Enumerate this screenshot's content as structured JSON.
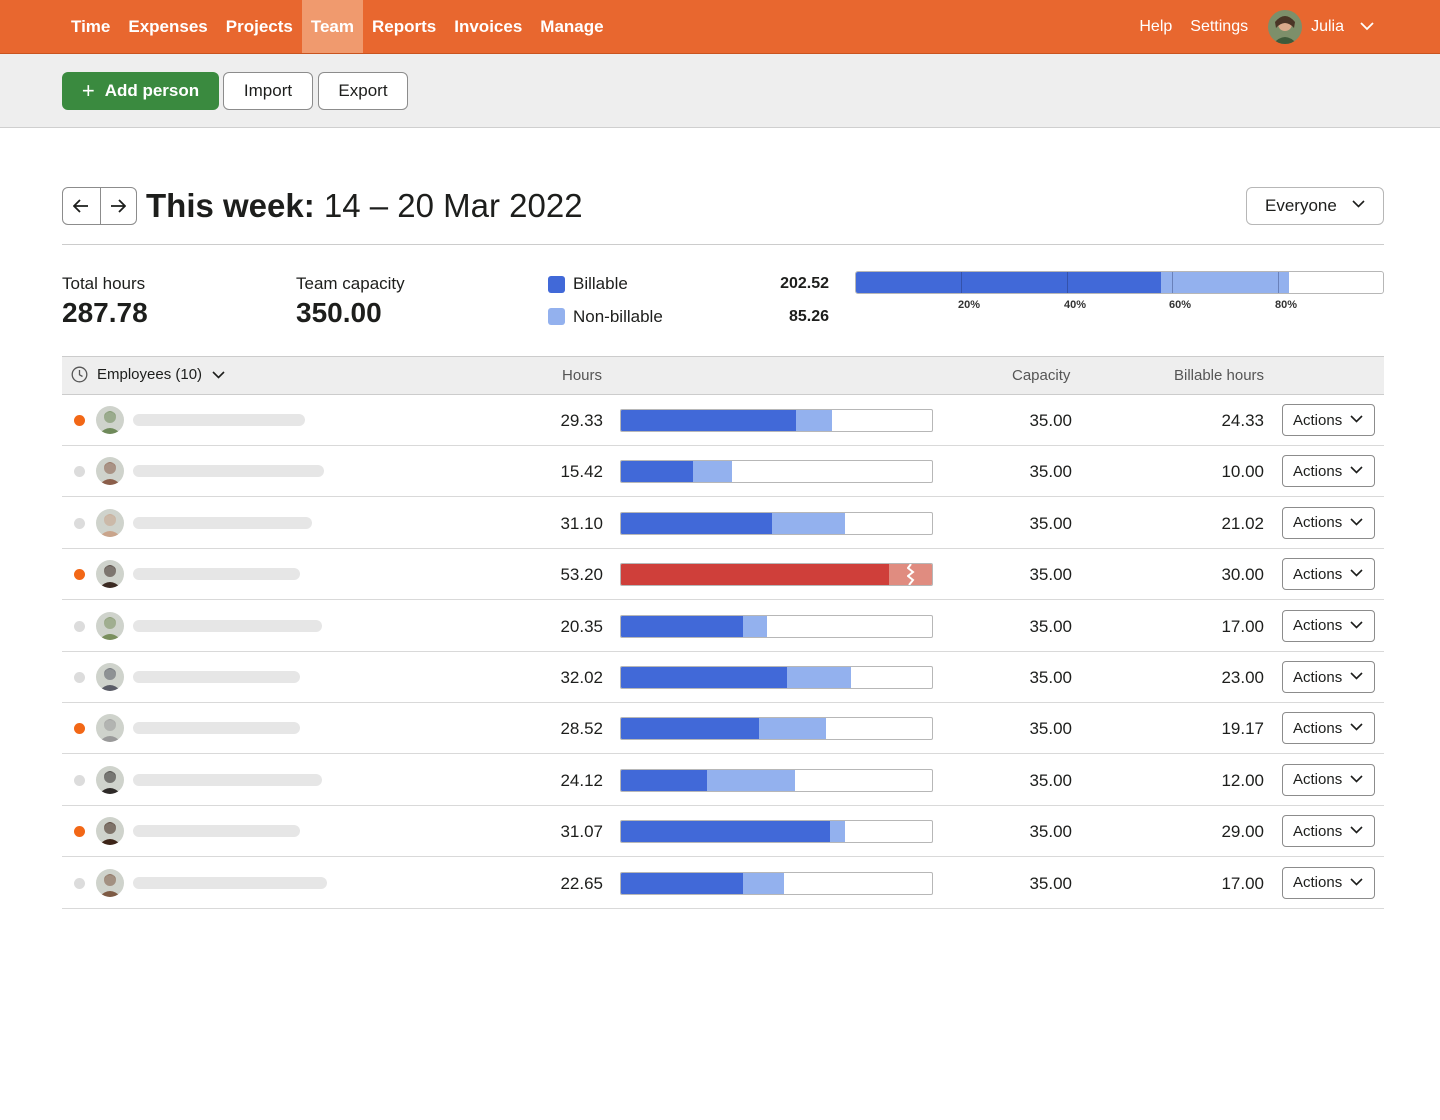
{
  "nav": {
    "items": [
      {
        "label": "Time",
        "active": false
      },
      {
        "label": "Expenses",
        "active": false
      },
      {
        "label": "Projects",
        "active": false
      },
      {
        "label": "Team",
        "active": true
      },
      {
        "label": "Reports",
        "active": false
      },
      {
        "label": "Invoices",
        "active": false
      },
      {
        "label": "Manage",
        "active": false
      }
    ],
    "help": "Help",
    "settings": "Settings",
    "user_name": "Julia"
  },
  "toolbar": {
    "add_person": "Add person",
    "add_icon": "plus-icon",
    "import": "Import",
    "export": "Export"
  },
  "week": {
    "title_bold": "This week:",
    "title_range": " 14 – 20 Mar 2022",
    "filter": "Everyone"
  },
  "summary": {
    "total_hours_label": "Total hours",
    "total_hours": "287.78",
    "capacity_label": "Team capacity",
    "capacity": "350.00",
    "billable_label": "Billable",
    "billable": "202.52",
    "nonbillable_label": "Non-billable",
    "nonbillable": "85.26",
    "bar_billable_fraction": 0.5786,
    "bar_nonbillable_fraction": 0.2436,
    "ticks": [
      "20%",
      "40%",
      "60%",
      "80%"
    ]
  },
  "table": {
    "employees_label": "Employees (10)",
    "col_hours": "Hours",
    "col_capacity": "Capacity",
    "col_billable": "Billable hours",
    "actions_label": "Actions",
    "rows": [
      {
        "status": "over-alert",
        "hours": "29.33",
        "h": 29.33,
        "b": 24.33,
        "capacity": "35.00",
        "billable": "24.33",
        "over": false,
        "avatar": "#6f8a5a"
      },
      {
        "status": "normal",
        "hours": "15.42",
        "h": 15.42,
        "b": 10.0,
        "capacity": "35.00",
        "billable": "10.00",
        "over": false,
        "avatar": "#8b5e4a"
      },
      {
        "status": "normal",
        "hours": "31.10",
        "h": 31.1,
        "b": 21.02,
        "capacity": "35.00",
        "billable": "21.02",
        "over": false,
        "avatar": "#c9a48b"
      },
      {
        "status": "over-alert",
        "hours": "53.20",
        "h": 53.2,
        "b": 30.0,
        "capacity": "35.00",
        "billable": "30.00",
        "over": true,
        "avatar": "#3b2a22"
      },
      {
        "status": "normal",
        "hours": "20.35",
        "h": 20.35,
        "b": 17.0,
        "capacity": "35.00",
        "billable": "17.00",
        "over": false,
        "avatar": "#7a8f5e"
      },
      {
        "status": "normal",
        "hours": "32.02",
        "h": 32.02,
        "b": 23.0,
        "capacity": "35.00",
        "billable": "23.00",
        "over": false,
        "avatar": "#5a5c66"
      },
      {
        "status": "over-alert",
        "hours": "28.52",
        "h": 28.52,
        "b": 19.17,
        "capacity": "35.00",
        "billable": "19.17",
        "over": false,
        "avatar": "#9a9a9a"
      },
      {
        "status": "normal",
        "hours": "24.12",
        "h": 24.12,
        "b": 12.0,
        "capacity": "35.00",
        "billable": "12.00",
        "over": false,
        "avatar": "#2e2a28"
      },
      {
        "status": "over-alert",
        "hours": "31.07",
        "h": 31.07,
        "b": 29.0,
        "capacity": "35.00",
        "billable": "29.00",
        "over": false,
        "avatar": "#3d2418"
      },
      {
        "status": "normal",
        "hours": "22.65",
        "h": 22.65,
        "b": 17.0,
        "capacity": "35.00",
        "billable": "17.00",
        "over": false,
        "avatar": "#7d5a44"
      }
    ]
  },
  "colors": {
    "brand": "#e8672f",
    "billable": "#4169d8",
    "nonbillable": "#93b1ee",
    "over": "#cf3f3a",
    "over_light": "#e08c80",
    "alert_dot": "#f26716",
    "muted_dot": "#dcdcdc",
    "primary_button": "#3a8a3f"
  }
}
